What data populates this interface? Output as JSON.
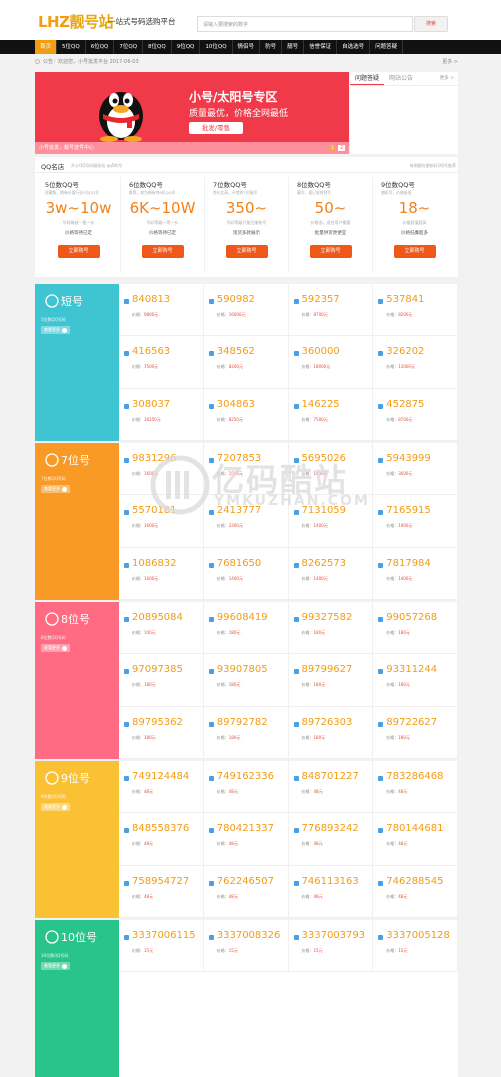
{
  "header": {
    "logo_main": "LHZ",
    "logo_cn": "靓号站",
    "slogan": "一站式号码选购平台",
    "search_placeholder": "请输入要搜索的数字",
    "search_button": "搜索"
  },
  "nav": {
    "items": [
      "首页",
      "5位QQ",
      "6位QQ",
      "7位QQ",
      "8位QQ",
      "9位QQ",
      "10位QQ",
      "情侣号",
      "豹号",
      "靓号",
      "信誉保证",
      "自选选号",
      "问题答疑"
    ]
  },
  "notice": {
    "label": "公告：",
    "text": "欢迎您，小号批发平台  2017-06-03",
    "more": "更多 >"
  },
  "banner": {
    "title": "小号/太阳号专区",
    "subtitle": "质量最优，价格全网最低",
    "button": "批发/零售",
    "caption": "小号批发，靓号选号中心",
    "pages": [
      "1",
      "2"
    ]
  },
  "side": {
    "tab1": "问题答疑",
    "tab2": "网站公告",
    "more": "更多 >"
  },
  "shop": {
    "title": "QQ名店",
    "sub": "开心QQ号码服务站 qq5的号",
    "right": "每周都在更新好QQ号推荐",
    "cards": [
      {
        "title": "5位数QQ号",
        "desc": "珍藏版，拥有价值行业5位QQ号",
        "big": "3w~10w",
        "note1": "号码稀缺一客一价",
        "note2": "价格等待已定",
        "btn": "立即购号"
      },
      {
        "title": "6位数QQ号",
        "desc": "推荐，较为稀有的6位QQ号",
        "big": "6K~10W",
        "note1": "号码等级一等一价",
        "note2": "价格等待已定",
        "btn": "立即购号"
      },
      {
        "title": "7位数QQ号",
        "desc": "性价比高，不错的7位靓号",
        "big": "350~",
        "note1": "号码等级只能注册账号",
        "note2": "现货多款展示",
        "btn": "立即购号"
      },
      {
        "title": "8位数QQ号",
        "desc": "靓号，现已安排到号",
        "big": "50~",
        "note1": "价格低，适合用户需要",
        "note2": "批量供货更便宜",
        "btn": "立即购号"
      },
      {
        "title": "9位数QQ号",
        "desc": "随机号，价格极低",
        "big": "18~",
        "note1": "价格超值超高",
        "note2": "价格低廉超多",
        "btn": "立即购号"
      }
    ]
  },
  "sections": [
    {
      "name": "短号",
      "desc": "5位数QQ号码",
      "btn": "查看更多",
      "color": "#3fc5d1",
      "cells": [
        [
          "840813",
          "9800元"
        ],
        [
          "590982",
          "16000元"
        ],
        [
          "592357",
          "8700元"
        ],
        [
          "537841",
          "8200元"
        ],
        [
          "416563",
          "7500元"
        ],
        [
          "348562",
          "8200元"
        ],
        [
          "360000",
          "18000元"
        ],
        [
          "326202",
          "13000元"
        ],
        [
          "308037",
          "16250元"
        ],
        [
          "304863",
          "8250元"
        ],
        [
          "146225",
          "7500元"
        ],
        [
          "452875",
          "8700元"
        ]
      ]
    },
    {
      "name": "7位号",
      "desc": "7位数QQ号码",
      "btn": "查看更多",
      "color": "#f99a26",
      "cells": [
        [
          "9831296",
          "1600元"
        ],
        [
          "7207853",
          "1500元"
        ],
        [
          "5695026",
          "1400元"
        ],
        [
          "5943999",
          "3600元"
        ],
        [
          "5570181",
          "1600元"
        ],
        [
          "2413777",
          "3300元"
        ],
        [
          "7131059",
          "1400元"
        ],
        [
          "7165915",
          "1900元"
        ],
        [
          "1086832",
          "1600元"
        ],
        [
          "7681650",
          "1400元"
        ],
        [
          "8262573",
          "1400元"
        ],
        [
          "7817984",
          "1400元"
        ]
      ]
    },
    {
      "name": "8位号",
      "desc": "8位数QQ号码",
      "btn": "查看更多",
      "color": "#ff6b82",
      "cells": [
        [
          "20895084",
          "100元"
        ],
        [
          "99608419",
          "180元"
        ],
        [
          "99327582",
          "180元"
        ],
        [
          "99057268",
          "180元"
        ],
        [
          "97097385",
          "180元"
        ],
        [
          "93907805",
          "180元"
        ],
        [
          "89799627",
          "180元"
        ],
        [
          "93311244",
          "180元"
        ],
        [
          "89795362",
          "180元"
        ],
        [
          "89792782",
          "180元"
        ],
        [
          "89726303",
          "180元"
        ],
        [
          "89722627",
          "180元"
        ]
      ]
    },
    {
      "name": "9位号",
      "desc": "9位数QQ号码",
      "btn": "查看更多",
      "color": "#fbc134",
      "cells": [
        [
          "749124484",
          "48元"
        ],
        [
          "749162336",
          "48元"
        ],
        [
          "848701227",
          "48元"
        ],
        [
          "783286468",
          "48元"
        ],
        [
          "848558376",
          "48元"
        ],
        [
          "780421337",
          "48元"
        ],
        [
          "776893242",
          "48元"
        ],
        [
          "780144681",
          "48元"
        ],
        [
          "758954727",
          "48元"
        ],
        [
          "762246507",
          "48元"
        ],
        [
          "746113163",
          "48元"
        ],
        [
          "746288545",
          "48元"
        ]
      ]
    },
    {
      "name": "10位号",
      "desc": "10位数QQ号码",
      "btn": "查看更多",
      "color": "#28c48c",
      "cells": [
        [
          "3337006115",
          "15元"
        ],
        [
          "3337008326",
          "15元"
        ],
        [
          "3337003793",
          "15元"
        ],
        [
          "3337005128",
          "15元"
        ]
      ]
    }
  ],
  "price_label": "价格：",
  "watermark": {
    "t1": "亿码酷站",
    "t2": "YMKUZHAN.COM"
  }
}
